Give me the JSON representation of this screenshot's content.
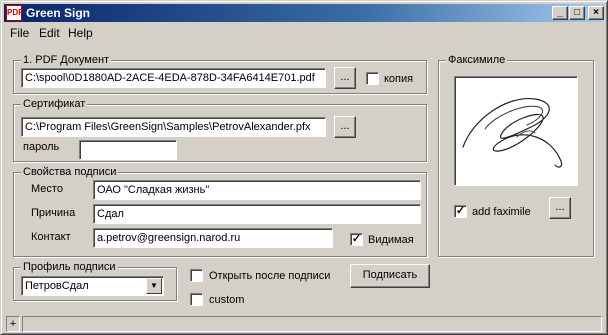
{
  "window": {
    "title": "Green Sign",
    "app_icon_text": "PDF",
    "minimize": "_",
    "maximize": "□",
    "close": "×"
  },
  "menu": {
    "file": "File",
    "edit": "Edit",
    "help": "Help"
  },
  "pdf_group": {
    "label": "1. PDF Документ",
    "path": "C:\\spool\\0D1880AD-2ACE-4EDA-878D-34FA6414E701.pdf",
    "browse_label": "...",
    "copy_label": "копия",
    "copy_checked": false
  },
  "cert_group": {
    "label": "Сертификат",
    "path": "C:\\Program Files\\GreenSign\\Samples\\PetrovAlexander.pfx",
    "browse_label": "...",
    "password_label": "пароль",
    "password_value": ""
  },
  "props_group": {
    "label": "Свойства подписи",
    "place_label": "Место",
    "place_value": "ОАО \"Сладкая жизнь\"",
    "reason_label": "Причина",
    "reason_value": "Сдал",
    "contact_label": "Контакт",
    "contact_value": "a.petrov@greensign.narod.ru",
    "visible_label": "Видимая",
    "visible_checked": true
  },
  "profile_group": {
    "label": "Профиль подписи",
    "selected": "ПетровСдал"
  },
  "options": {
    "open_after_label": "Открыть после подписи",
    "open_after_checked": false,
    "custom_label": "custom",
    "custom_checked": false,
    "sign_button": "Подписать"
  },
  "facsimile_group": {
    "label": "Факсимиле",
    "add_label": "add faximile",
    "add_checked": true,
    "browse_label": "..."
  },
  "status": {
    "panel1": "+",
    "check_mark": "✓"
  }
}
